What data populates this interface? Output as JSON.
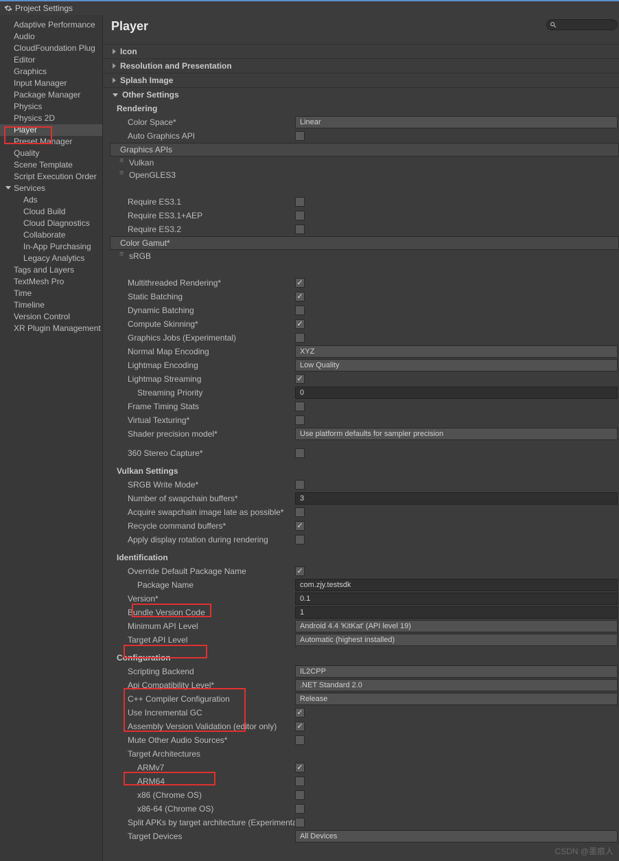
{
  "window": {
    "title": "Project Settings"
  },
  "sidebar": {
    "items": [
      "Adaptive Performance",
      "Audio",
      "CloudFoundation Plug",
      "Editor",
      "Graphics",
      "Input Manager",
      "Package Manager",
      "Physics",
      "Physics 2D",
      "Player",
      "Preset Manager",
      "Quality",
      "Scene Template",
      "Script Execution Order",
      "Services",
      "Ads",
      "Cloud Build",
      "Cloud Diagnostics",
      "Collaborate",
      "In-App Purchasing",
      "Legacy Analytics",
      "Tags and Layers",
      "TextMesh Pro",
      "Time",
      "Timeline",
      "Version Control",
      "XR Plugin Management"
    ]
  },
  "header": "Player",
  "foldouts": {
    "icon": "Icon",
    "resolution": "Resolution and Presentation",
    "splash": "Splash Image",
    "other": "Other Settings"
  },
  "rendering": {
    "title": "Rendering",
    "colorSpace": {
      "label": "Color Space*",
      "value": "Linear"
    },
    "autoApi": {
      "label": "Auto Graphics API"
    },
    "apisHeader": "Graphics APIs",
    "apis": [
      "Vulkan",
      "OpenGLES3"
    ],
    "reqES31": "Require ES3.1",
    "reqES31AEP": "Require ES3.1+AEP",
    "reqES32": "Require ES3.2",
    "gamutHeader": "Color Gamut*",
    "gamut": "sRGB",
    "multithread": "Multithreaded Rendering*",
    "staticBatch": "Static Batching",
    "dynBatch": "Dynamic Batching",
    "computeSkin": "Compute Skinning*",
    "gjobs": "Graphics Jobs (Experimental)",
    "normalEnc": {
      "label": "Normal Map Encoding",
      "value": "XYZ"
    },
    "lmEnc": {
      "label": "Lightmap Encoding",
      "value": "Low Quality"
    },
    "lmStream": "Lightmap Streaming",
    "streamPrio": {
      "label": "Streaming Priority",
      "value": "0"
    },
    "frameTiming": "Frame Timing Stats",
    "virtTex": "Virtual Texturing*",
    "shaderPrec": {
      "label": "Shader precision model*",
      "value": "Use platform defaults for sampler precision"
    },
    "stereo": "360 Stereo Capture*"
  },
  "vulkan": {
    "title": "Vulkan Settings",
    "srgb": "SRGB Write Mode*",
    "swap": {
      "label": "Number of swapchain buffers*",
      "value": "3"
    },
    "acquire": "Acquire swapchain image late as possible*",
    "recycle": "Recycle command buffers*",
    "apply": "Apply display rotation during rendering"
  },
  "ident": {
    "title": "Identification",
    "override": "Override Default Package Name",
    "pkg": {
      "label": "Package Name",
      "value": "com.zjy.testsdk"
    },
    "ver": {
      "label": "Version*",
      "value": "0.1"
    },
    "bundle": {
      "label": "Bundle Version Code",
      "value": "1"
    },
    "minApi": {
      "label": "Minimum API Level",
      "value": "Android 4.4 'KitKat' (API level 19)"
    },
    "tgtApi": {
      "label": "Target API Level",
      "value": "Automatic (highest installed)"
    }
  },
  "config": {
    "title": "Configuration",
    "backend": {
      "label": "Scripting Backend",
      "value": "IL2CPP"
    },
    "compat": {
      "label": "Api Compatibility Level*",
      "value": ".NET Standard 2.0"
    },
    "cpp": {
      "label": "C++ Compiler Configuration",
      "value": "Release"
    },
    "incGC": "Use Incremental GC",
    "asmVal": "Assembly Version Validation (editor only)",
    "mute": "Mute Other Audio Sources*",
    "tarch": "Target Architectures",
    "arm7": "ARMv7",
    "arm64": "ARM64",
    "x86": "x86 (Chrome OS)",
    "x8664": "x86-64 (Chrome OS)",
    "split": "Split APKs by target architecture (Experimenta",
    "tdev": {
      "label": "Target Devices",
      "value": "All Devices"
    }
  },
  "watermark": "CSDN @墨痕人"
}
